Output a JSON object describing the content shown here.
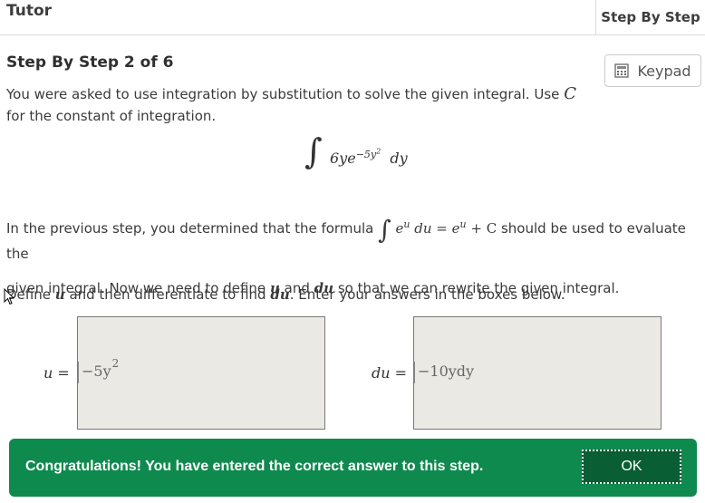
{
  "header": {
    "title": "Tutor",
    "tab_label": "Step By Step"
  },
  "step": {
    "title": "Step By Step 2 of 6",
    "keypad_label": "Keypad",
    "intro_text": "You were asked to use integration by substitution to solve the given integral. Use",
    "intro_var": "C",
    "intro_text_2": "for the constant of integration.",
    "integral": {
      "integrand": "6ye",
      "exponent": "−5y",
      "exp_power": "2",
      "differential": "dy"
    },
    "prev_step_before": "In the previous step, you determined that the formula",
    "formula_integrand": "e",
    "formula_sup": "u",
    "formula_rest": "du = e",
    "formula_sup2": "u",
    "formula_tail": "+ C",
    "prev_step_after": "should be used to evaluate the",
    "line2_before": "given integral. Now we need to define",
    "line2_u": "u",
    "line2_and": "and",
    "line2_du": "du",
    "line2_after": "so that we can rewrite the given integral.",
    "instr_before": "Define",
    "instr_u": "u",
    "instr_mid": "and then differentiate to find",
    "instr_du": "du",
    "instr_after": ". Enter your answers in the boxes below."
  },
  "answers": {
    "u_label": "u =",
    "u_value": "−5y",
    "u_power": "2",
    "du_label": "du =",
    "du_value": "−10ydy"
  },
  "banner": {
    "message": "Congratulations! You have entered the correct answer to this step.",
    "ok_label": "OK",
    "color": "#0f8a4e"
  }
}
